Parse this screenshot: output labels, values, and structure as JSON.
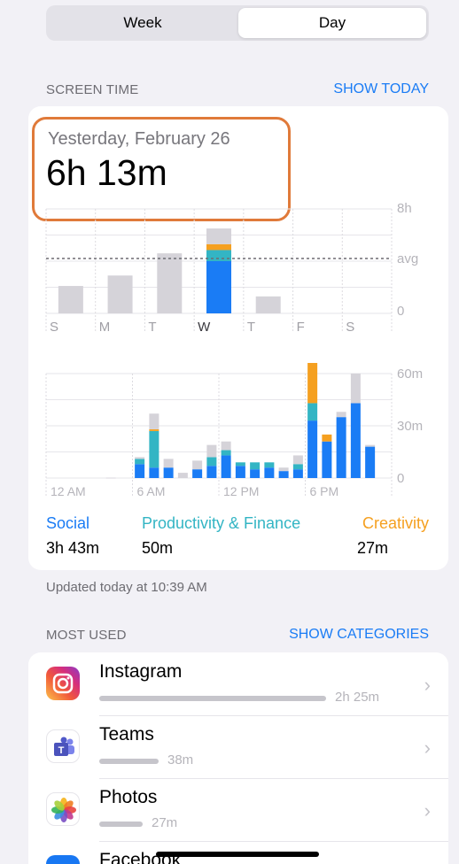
{
  "segmented": {
    "week_label": "Week",
    "day_label": "Day",
    "selected": "Day"
  },
  "screen_time": {
    "section_label": "SCREEN TIME",
    "show_today_label": "SHOW TODAY",
    "date": "Yesterday, February 26",
    "total": "6h 13m"
  },
  "colors": {
    "social": "#1a7cf5",
    "productivity": "#33b5c4",
    "creativity": "#f5a020",
    "other": "#d5d3d9",
    "highlight_border": "#e07a3a",
    "link": "#1a7cf5"
  },
  "chart_data": [
    {
      "type": "bar",
      "categories": [
        "S",
        "M",
        "T",
        "W",
        "T",
        "F",
        "S"
      ],
      "ylim": [
        0,
        8
      ],
      "y_tick_labels": [
        "8h",
        "avg",
        "0"
      ],
      "avg": 4.2,
      "series": [
        {
          "name": "Social",
          "values": [
            0,
            0,
            0,
            4.0,
            0,
            0,
            0
          ]
        },
        {
          "name": "Productivity & Finance",
          "values": [
            0,
            0,
            0,
            0.85,
            0,
            0,
            0
          ]
        },
        {
          "name": "Creativity",
          "values": [
            0,
            0,
            0,
            0.45,
            0,
            0,
            0
          ]
        },
        {
          "values": [
            2.1,
            2.9,
            4.6,
            1.2,
            1.3,
            0,
            0
          ]
        }
      ],
      "selected_index": 3
    },
    {
      "type": "bar",
      "x_tick_labels": [
        "12 AM",
        "6 AM",
        "12 PM",
        "6 PM"
      ],
      "y_tick_labels": [
        "60m",
        "30m",
        "0"
      ],
      "ylim": [
        0,
        60
      ],
      "hours": [
        "0",
        "1",
        "2",
        "3",
        "4",
        "5",
        "6",
        "7",
        "8",
        "9",
        "10",
        "11",
        "12",
        "13",
        "14",
        "15",
        "16",
        "17",
        "18",
        "19",
        "20",
        "21",
        "22",
        "23"
      ],
      "series": [
        {
          "name": "Social",
          "values": [
            0,
            0,
            0,
            0,
            0,
            0,
            8,
            6,
            6,
            0,
            5,
            7,
            13,
            7,
            5,
            6,
            4,
            5,
            33,
            21,
            35,
            43,
            18,
            0
          ]
        },
        {
          "name": "Productivity & Finance",
          "values": [
            0,
            0,
            0,
            0,
            0,
            0,
            3,
            21,
            0,
            0,
            0,
            5,
            3,
            2,
            4,
            3,
            0,
            3,
            10,
            0,
            0,
            0,
            0,
            0
          ]
        },
        {
          "name": "Creativity",
          "values": [
            0,
            0,
            0,
            0,
            0,
            0,
            0,
            1,
            0,
            0,
            0,
            0,
            0,
            0,
            0,
            0,
            0,
            0,
            24,
            4,
            0,
            0,
            0,
            0
          ]
        },
        {
          "values": [
            0,
            0,
            0,
            0,
            0.2,
            0,
            1,
            9,
            5,
            3,
            5,
            7,
            5,
            0,
            0,
            0,
            2,
            5,
            2,
            0,
            3,
            17,
            1,
            0
          ]
        }
      ]
    }
  ],
  "categories": [
    {
      "name": "Social",
      "value": "3h 43m"
    },
    {
      "name": "Productivity & Finance",
      "value": "50m"
    },
    {
      "name": "Creativity",
      "value": "27m"
    }
  ],
  "updated": "Updated today at 10:39 AM",
  "most_used": {
    "section_label": "MOST USED",
    "show_categories_label": "SHOW CATEGORIES",
    "apps": [
      {
        "name": "Instagram",
        "time": "2h 25m",
        "usage_fraction": 1.0,
        "icon": "instagram-icon"
      },
      {
        "name": "Teams",
        "time": "38m",
        "usage_fraction": 0.26,
        "icon": "teams-icon"
      },
      {
        "name": "Photos",
        "time": "27m",
        "usage_fraction": 0.19,
        "icon": "photos-icon"
      },
      {
        "name": "Facebook",
        "icon": "facebook-icon"
      }
    ]
  }
}
